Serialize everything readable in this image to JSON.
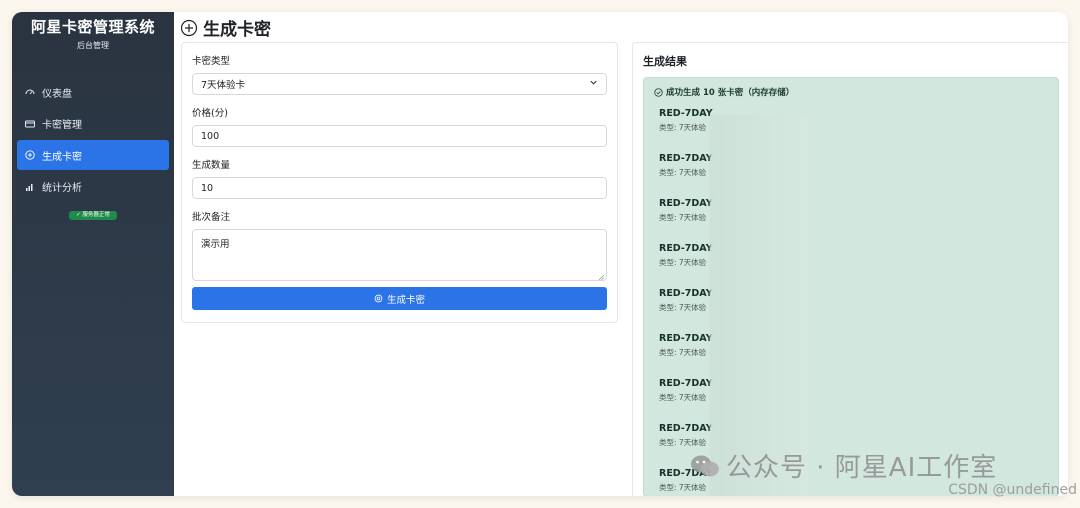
{
  "sidebar": {
    "title": "阿星卡密管理系统",
    "subtitle": "后台管理",
    "items": [
      {
        "label": "仪表盘",
        "icon": "dashboard-icon"
      },
      {
        "label": "卡密管理",
        "icon": "card-icon"
      },
      {
        "label": "生成卡密",
        "icon": "plus-circle-icon",
        "active": true
      },
      {
        "label": "统计分析",
        "icon": "bar-chart-icon"
      }
    ],
    "status": "服务器正常"
  },
  "header": {
    "title": "生成卡密"
  },
  "form": {
    "type_label": "卡密类型",
    "type_value": "7天体验卡",
    "price_label": "价格(分)",
    "price_value": "100",
    "count_label": "生成数量",
    "count_value": "10",
    "note_label": "批次备注",
    "note_value": "演示用",
    "submit_label": "生成卡密"
  },
  "result": {
    "title": "生成结果",
    "success_text": "成功生成 10 张卡密（内存存储）",
    "keys": [
      {
        "code": "RED-7DAY",
        "type": "类型: 7天体验"
      },
      {
        "code": "RED-7DAY",
        "type": "类型: 7天体验"
      },
      {
        "code": "RED-7DAY",
        "type": "类型: 7天体验"
      },
      {
        "code": "RED-7DAY",
        "type": "类型: 7天体验"
      },
      {
        "code": "RED-7DAY",
        "type": "类型: 7天体验"
      },
      {
        "code": "RED-7DAY",
        "type": "类型: 7天体验"
      },
      {
        "code": "RED-7DAY",
        "type": "类型: 7天体验"
      },
      {
        "code": "RED-7DAY",
        "type": "类型: 7天体验"
      },
      {
        "code": "RED-7DAY",
        "type": "类型: 7天体验"
      }
    ]
  },
  "watermark": {
    "text": "公众号 · 阿星AI工作室",
    "credit": "CSDN @undefined"
  },
  "colors": {
    "sidebar_bg": "#2a3440",
    "accent": "#2b74e8",
    "success_bg": "#d2e7de",
    "status_green": "#1f8a4a"
  }
}
